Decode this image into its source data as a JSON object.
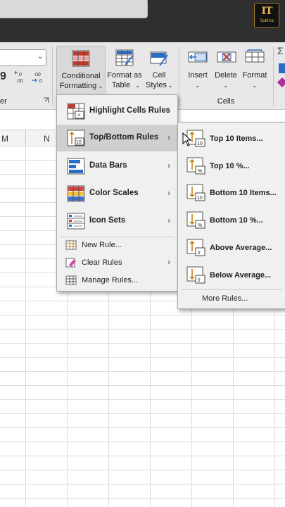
{
  "ribbon": {
    "conditional_formatting": {
      "line1": "Conditional",
      "line2": "Formatting"
    },
    "format_as_table": {
      "line1": "Format as",
      "line2": "Table"
    },
    "cell_styles": {
      "line1": "Cell",
      "line2": "Styles"
    },
    "insert": "Insert",
    "delete": "Delete",
    "format": "Format",
    "cells_group": "Cells",
    "number_group_partial": "er",
    "left_dropdown_icon": "chevron-down-icon"
  },
  "column_headers": [
    "M",
    "N"
  ],
  "logo": {
    "top": "IT",
    "bottom": "Subhra"
  },
  "cf_menu": {
    "items": [
      {
        "label": "Highlight Cells Rules",
        "icon": "highlight-cells-rules-icon"
      },
      {
        "label": "Top/Bottom Rules",
        "icon": "top-bottom-rules-icon"
      },
      {
        "label": "Data Bars",
        "icon": "data-bars-icon"
      },
      {
        "label": "Color Scales",
        "icon": "color-scales-icon"
      },
      {
        "label": "Icon Sets",
        "icon": "icon-sets-icon"
      }
    ],
    "new_rule": "New Rule...",
    "clear_rules": "Clear Rules",
    "manage_rules": "Manage Rules..."
  },
  "top_bottom_submenu": {
    "items": [
      {
        "label": "Top 10 Items...",
        "icon": "top-10-items-icon"
      },
      {
        "label": "Top 10 %...",
        "icon": "top-10-percent-icon"
      },
      {
        "label": "Bottom 10 Items...",
        "icon": "bottom-10-items-icon"
      },
      {
        "label": "Bottom 10 %...",
        "icon": "bottom-10-percent-icon"
      },
      {
        "label": "Above Average...",
        "icon": "above-average-icon"
      },
      {
        "label": "Below Average...",
        "icon": "below-average-icon"
      }
    ],
    "more_rules": "More Rules..."
  },
  "colors": {
    "highlight": "#cfcfcf",
    "menu_bg": "#f0f0f0",
    "ribbon_bg": "#e8e8e8",
    "accent_blue": "#2b6cc4",
    "accent_red": "#c0392b"
  }
}
